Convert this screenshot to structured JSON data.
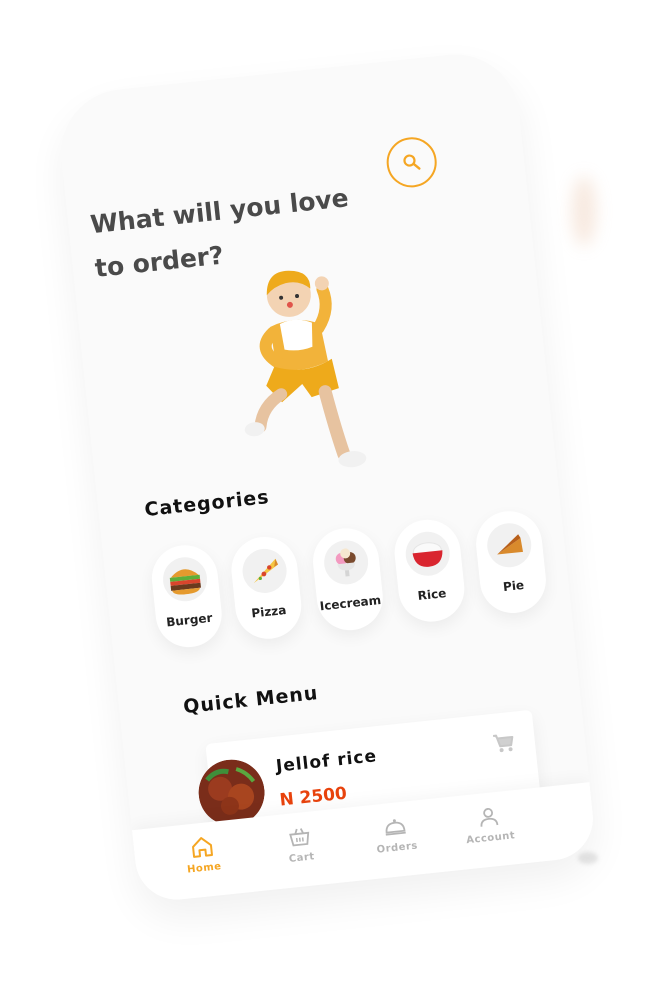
{
  "header": {
    "title": "What will you love to order?",
    "search_icon": "search-icon"
  },
  "categories": {
    "title": "Categories",
    "items": [
      {
        "label": "Burger",
        "icon": "burger-icon"
      },
      {
        "label": "Pizza",
        "icon": "pizza-icon"
      },
      {
        "label": "Icecream",
        "icon": "icecream-icon"
      },
      {
        "label": "Rice",
        "icon": "rice-icon"
      },
      {
        "label": "Pie",
        "icon": "pie-icon"
      }
    ]
  },
  "quick_menu": {
    "title": "Quick Menu",
    "items": [
      {
        "name": "Jellof rice",
        "price": "N 2500"
      }
    ]
  },
  "bottom_nav": {
    "items": [
      {
        "label": "Home",
        "icon": "home-icon",
        "active": true
      },
      {
        "label": "Cart",
        "icon": "cart-icon",
        "active": false
      },
      {
        "label": "Orders",
        "icon": "orders-icon",
        "active": false
      },
      {
        "label": "Account",
        "icon": "account-icon",
        "active": false
      }
    ]
  },
  "colors": {
    "accent": "#f5a623",
    "price": "#e8430d",
    "text": "#111111",
    "muted": "#b5b5b5"
  }
}
